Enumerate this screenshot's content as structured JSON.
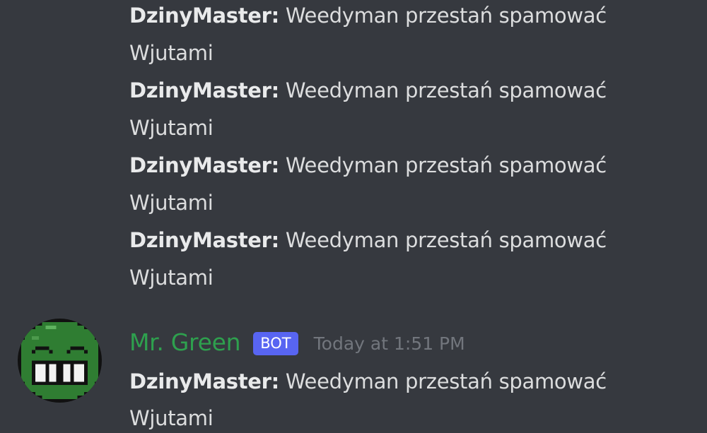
{
  "messages": [
    {
      "author": "DzinyMaster:",
      "text": " Weedyman przestań spamować",
      "continuation": "Wjutami"
    },
    {
      "author": "DzinyMaster:",
      "text": " Weedyman przestań spamować",
      "continuation": "Wjutami"
    },
    {
      "author": "DzinyMaster:",
      "text": " Weedyman przestań spamować",
      "continuation": "Wjutami"
    },
    {
      "author": "DzinyMaster:",
      "text": " Weedyman przestań spamować",
      "continuation": "Wjutami"
    }
  ],
  "bot_group": {
    "username": "Mr. Green",
    "tag": "BOT",
    "timestamp": "Today at 1:51 PM",
    "avatar_icon": "grinning-face-icon",
    "message": {
      "author": "DzinyMaster:",
      "text": " Weedyman przestań spamować",
      "continuation": "Wjutami"
    }
  },
  "colors": {
    "background": "#36393f",
    "username": "#2ea04e",
    "bot_tag": "#5865f2",
    "text": "#dcddde",
    "timestamp": "#72767d"
  }
}
